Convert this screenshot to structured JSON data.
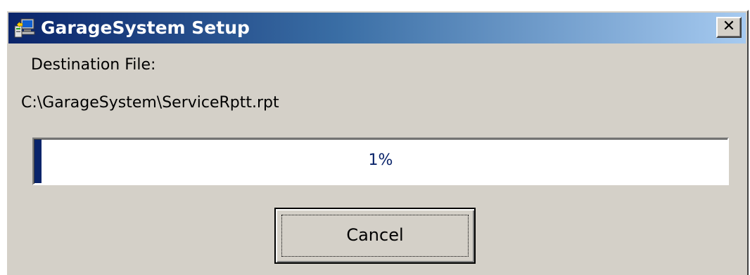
{
  "window": {
    "title": "GarageSystem Setup",
    "close_glyph": "✕",
    "icon": "setup-computer-icon"
  },
  "content": {
    "destination_label": "Destination File:",
    "destination_path": "C:\\GarageSystem\\ServiceRptt.rpt"
  },
  "progress": {
    "percent": 1,
    "label": "1%"
  },
  "buttons": {
    "cancel_label": "Cancel"
  },
  "colors": {
    "title_start": "#0a246a",
    "title_end": "#a6caf0",
    "face": "#d4d0c8",
    "progress_fill": "#0a246a"
  }
}
